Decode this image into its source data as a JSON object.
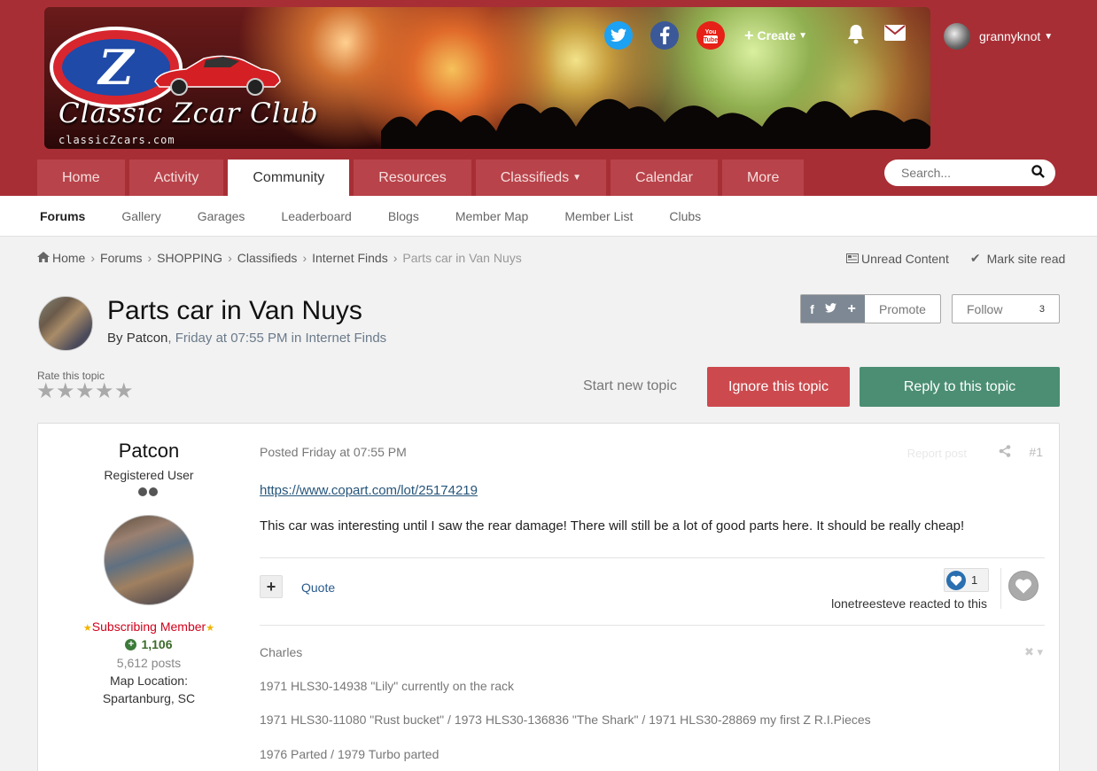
{
  "site": {
    "logo_title": "Classic Zcar Club",
    "logo_url": "classicZcars.com",
    "logo_letter": "Z"
  },
  "header": {
    "create_label": "Create",
    "username": "grannyknot",
    "icons": [
      "twitter-icon",
      "facebook-icon",
      "youtube-icon",
      "bell-icon",
      "mail-icon"
    ]
  },
  "nav": {
    "tabs": [
      {
        "label": "Home"
      },
      {
        "label": "Activity"
      },
      {
        "label": "Community"
      },
      {
        "label": "Resources"
      },
      {
        "label": "Classifieds"
      },
      {
        "label": "Calendar"
      },
      {
        "label": "More"
      }
    ],
    "active": "Community",
    "search_placeholder": "Search..."
  },
  "subnav": {
    "items": [
      "Forums",
      "Gallery",
      "Garages",
      "Leaderboard",
      "Blogs",
      "Member Map",
      "Member List",
      "Clubs"
    ],
    "active": "Forums"
  },
  "breadcrumb": {
    "items": [
      "Home",
      "Forums",
      "SHOPPING",
      "Classifieds",
      "Internet Finds",
      "Parts car in Van Nuys"
    ],
    "unread": "Unread Content",
    "mark_read": "Mark site read"
  },
  "topic": {
    "title": "Parts car in Van Nuys",
    "by": "By",
    "author": "Patcon",
    "meta_rest": ", Friday at 07:55 PM in Internet Finds",
    "promote": "Promote",
    "follow": "Follow",
    "follow_count": "3",
    "rate_label": "Rate this topic",
    "start_new": "Start new topic",
    "ignore": "Ignore this topic",
    "reply": "Reply to this topic"
  },
  "post": {
    "author_name": "Patcon",
    "author_role": "Registered User",
    "member_tag": "Subscribing Member",
    "reputation": "1,106",
    "posts": "5,612 posts",
    "map_label": "Map Location:",
    "map_value": "Spartanburg, SC",
    "posted": "Posted Friday at 07:55 PM",
    "report": "Report post",
    "number": "#1",
    "link": "https://www.copart.com/lot/25174219",
    "body": "This car was interesting until I saw the rear damage! There will still be a lot of good parts here. It should be really cheap!",
    "quote": "Quote",
    "reaction_count": "1",
    "reacted_text": "lonetreesteve reacted to this",
    "signature": [
      "Charles",
      "1971 HLS30-14938 \"Lily\" currently on the rack",
      "1971 HLS30-11080 \"Rust bucket\" / 1973 HLS30-136836 \"The Shark\" / 1971 HLS30-28869 my first Z  R.I.Pieces",
      "1976 Parted / 1979 Turbo parted"
    ]
  },
  "colors": {
    "header_bg": "#a82e35",
    "tab_bg": "#b8434a",
    "ignore_bg": "#cc4a4e",
    "reply_bg": "#4b8e74"
  }
}
